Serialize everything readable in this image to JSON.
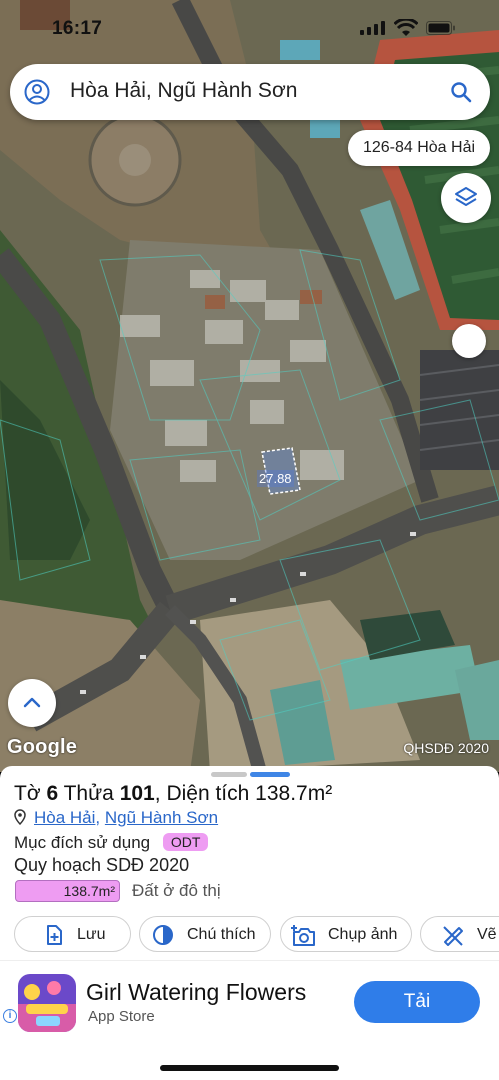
{
  "status_bar": {
    "time": "16:17"
  },
  "search": {
    "query": "Hòa Hải, Ngũ Hành Sơn"
  },
  "map": {
    "address_chip": "126-84 Hòa Hải",
    "plot_label": "27.88",
    "attribution": "Google",
    "overlay_source": "QHSDĐ 2020"
  },
  "parcel": {
    "to_label": "Tờ",
    "to_value": "6",
    "thua_label": "Thửa",
    "thua_value": "101",
    "area_label": "Diện tích",
    "area_value": "138.7m²",
    "ward": "Hòa Hải",
    "district": "Ngũ Hành Sơn",
    "purpose_label": "Mục đích sử dụng",
    "purpose_code": "ODT",
    "plan_label": "Quy hoạch SDĐ 2020",
    "plan_area": "138.7m²",
    "plan_use": "Đất ở đô thị",
    "plan_color": "#ee9cf2"
  },
  "actions": [
    {
      "label": "Lưu",
      "icon": "add-document-icon"
    },
    {
      "label": "Chú thích",
      "icon": "contrast-icon"
    },
    {
      "label": "Chụp ảnh",
      "icon": "camera-plus-icon"
    },
    {
      "label": "Vẽ",
      "icon": "measure-icon"
    }
  ],
  "ad": {
    "title": "Girl Watering Flowers",
    "subtitle": "App Store",
    "cta": "Tải",
    "cta_color": "#2f7de9"
  }
}
